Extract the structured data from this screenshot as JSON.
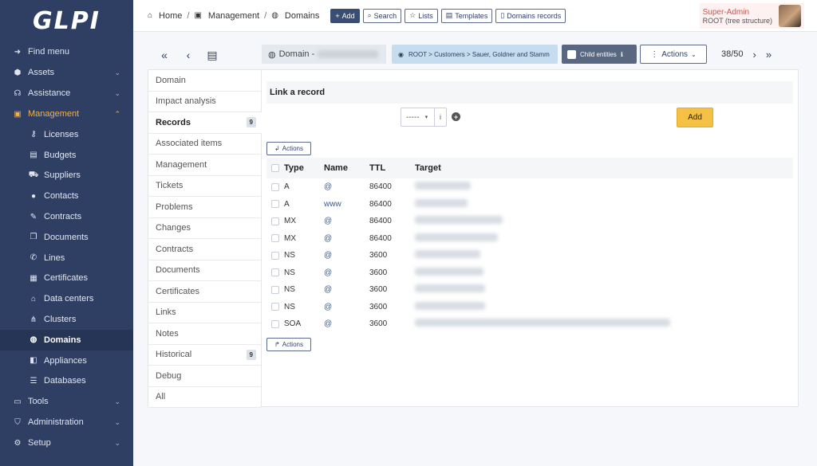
{
  "app": {
    "logo": "GLPI"
  },
  "sidebar": {
    "find_menu": "Find menu",
    "items": [
      {
        "label": "Assets",
        "icon": "cube-icon"
      },
      {
        "label": "Assistance",
        "icon": "headset-icon"
      },
      {
        "label": "Management",
        "icon": "wallet-icon"
      }
    ],
    "sub_items": [
      {
        "label": "Licenses",
        "icon": "key-icon"
      },
      {
        "label": "Budgets",
        "icon": "calculator-icon"
      },
      {
        "label": "Suppliers",
        "icon": "truck-icon"
      },
      {
        "label": "Contacts",
        "icon": "user-icon"
      },
      {
        "label": "Contracts",
        "icon": "signature-icon"
      },
      {
        "label": "Documents",
        "icon": "files-icon"
      },
      {
        "label": "Lines",
        "icon": "phone-icon"
      },
      {
        "label": "Certificates",
        "icon": "certificate-icon"
      },
      {
        "label": "Data centers",
        "icon": "building-icon"
      },
      {
        "label": "Clusters",
        "icon": "sitemap-icon"
      },
      {
        "label": "Domains",
        "icon": "globe-icon"
      },
      {
        "label": "Appliances",
        "icon": "plug-icon"
      },
      {
        "label": "Databases",
        "icon": "database-icon"
      }
    ],
    "bottom_items": [
      {
        "label": "Tools",
        "icon": "briefcase-icon"
      },
      {
        "label": "Administration",
        "icon": "shield-icon"
      },
      {
        "label": "Setup",
        "icon": "gear-icon"
      }
    ]
  },
  "topbar": {
    "breadcrumb": [
      "Home",
      "Management",
      "Domains"
    ],
    "buttons": {
      "add": "Add",
      "search": "Search",
      "lists": "Lists",
      "templates": "Templates",
      "domains_records": "Domains records"
    },
    "user": {
      "name": "Super-Admin",
      "entity": "ROOT (tree structure)"
    }
  },
  "toolbar": {
    "domain_label": "Domain -",
    "entity_path": "ROOT > Customers > Sauer, Goldner and Stamm",
    "child_entities": "Child entities",
    "actions": "Actions",
    "pager": "38/50"
  },
  "tabs": [
    {
      "label": "Domain"
    },
    {
      "label": "Impact analysis"
    },
    {
      "label": "Records",
      "badge": "9"
    },
    {
      "label": "Associated items"
    },
    {
      "label": "Management"
    },
    {
      "label": "Tickets"
    },
    {
      "label": "Problems"
    },
    {
      "label": "Changes"
    },
    {
      "label": "Contracts"
    },
    {
      "label": "Documents"
    },
    {
      "label": "Certificates"
    },
    {
      "label": "Links"
    },
    {
      "label": "Notes"
    },
    {
      "label": "Historical",
      "badge": "9"
    },
    {
      "label": "Debug"
    },
    {
      "label": "All"
    }
  ],
  "panel": {
    "title": "Link a record",
    "select_value": "-----",
    "info": "i",
    "add": "Add",
    "actions": "Actions",
    "columns": [
      "Type",
      "Name",
      "TTL",
      "Target"
    ],
    "rows": [
      {
        "type": "A",
        "name": "@",
        "ttl": "86400"
      },
      {
        "type": "A",
        "name": "www",
        "ttl": "86400"
      },
      {
        "type": "MX",
        "name": "@",
        "ttl": "86400"
      },
      {
        "type": "MX",
        "name": "@",
        "ttl": "86400"
      },
      {
        "type": "NS",
        "name": "@",
        "ttl": "3600"
      },
      {
        "type": "NS",
        "name": "@",
        "ttl": "3600"
      },
      {
        "type": "NS",
        "name": "@",
        "ttl": "3600"
      },
      {
        "type": "NS",
        "name": "@",
        "ttl": "3600"
      },
      {
        "type": "SOA",
        "name": "@",
        "ttl": "3600"
      }
    ]
  }
}
